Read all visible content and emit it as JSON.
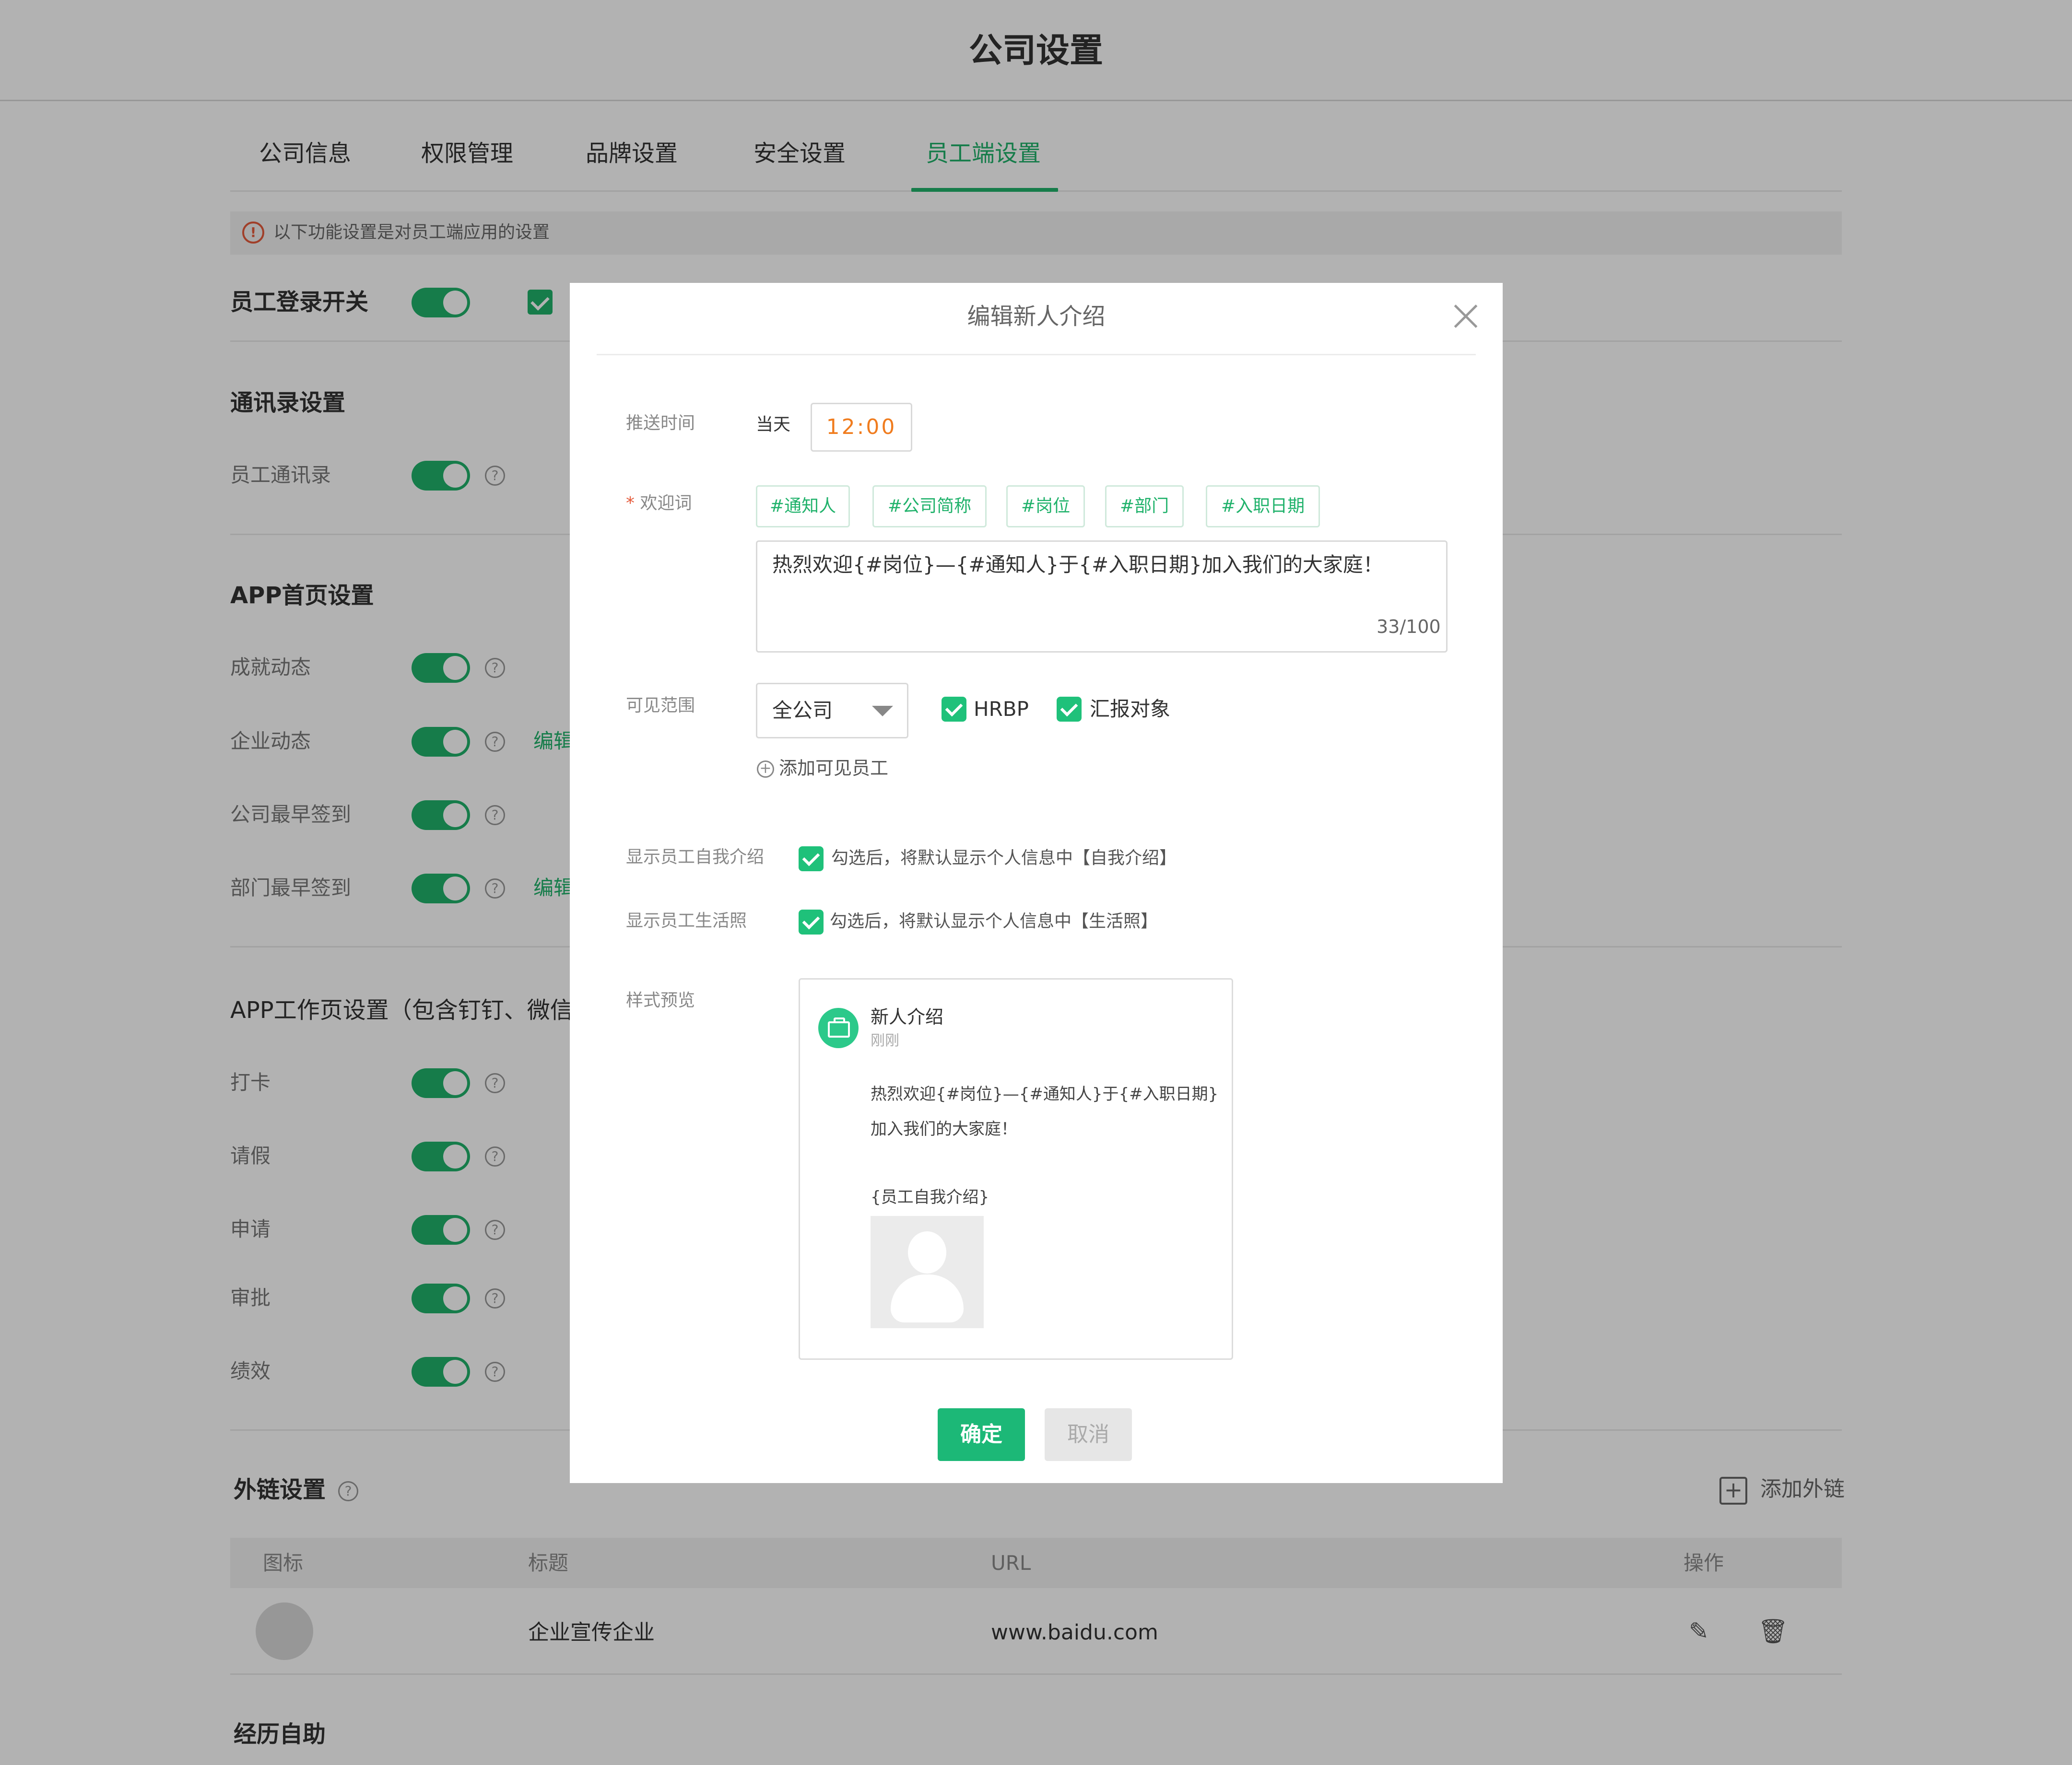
{
  "page": {
    "title": "公司设置"
  },
  "tabs": [
    {
      "label": "公司信息"
    },
    {
      "label": "权限管理"
    },
    {
      "label": "品牌设置"
    },
    {
      "label": "安全设置"
    },
    {
      "label": "员工端设置",
      "active": true
    }
  ],
  "notice": {
    "text": "以下功能设置是对员工端应用的设置"
  },
  "login_switch": {
    "label": "员工登录开关",
    "enabled": true
  },
  "contacts": {
    "title": "通讯录设置",
    "items": [
      {
        "label": "员工通讯录",
        "enabled": true
      }
    ]
  },
  "app_home": {
    "title": "APP首页设置",
    "items": [
      {
        "label": "成就动态",
        "enabled": true
      },
      {
        "label": "企业动态",
        "enabled": true,
        "edit": "编辑"
      },
      {
        "label": "公司最早签到",
        "enabled": true
      },
      {
        "label": "部门最早签到",
        "enabled": true,
        "edit": "编辑"
      }
    ]
  },
  "app_work": {
    "title": "APP工作页设置（包含钉钉、微信",
    "items": [
      {
        "label": "打卡",
        "enabled": true
      },
      {
        "label": "请假",
        "enabled": true
      },
      {
        "label": "申请",
        "enabled": true
      },
      {
        "label": "审批",
        "enabled": true
      },
      {
        "label": "绩效",
        "enabled": true
      }
    ]
  },
  "external_links": {
    "title": "外链设置",
    "add_label": "添加外链",
    "columns": [
      "图标",
      "标题",
      "URL",
      "操作"
    ],
    "rows": [
      {
        "title": "企业宣传企业",
        "url": "www.baidu.com"
      }
    ]
  },
  "bottom_section": {
    "title": "经历自助"
  },
  "modal": {
    "title": "编辑新人介绍",
    "push_time": {
      "label": "推送时间",
      "day": "当天",
      "time": "12:00"
    },
    "welcome": {
      "required_mark": "*",
      "label": "欢迎词",
      "tags": [
        "#通知人",
        "#公司简称",
        "#岗位",
        "#部门",
        "#入职日期"
      ],
      "text": "热烈欢迎{#岗位}—{#通知人}于{#入职日期}加入我们的大家庭！",
      "count": "33/100"
    },
    "visibility": {
      "label": "可见范围",
      "select_value": "全公司",
      "checkboxes": [
        {
          "label": "HRBP",
          "checked": true
        },
        {
          "label": "汇报对象",
          "checked": true
        }
      ],
      "add_label": "添加可见员工"
    },
    "show_intro": {
      "label": "显示员工自我介绍",
      "checked": true,
      "text": "勾选后，将默认显示个人信息中【自我介绍】"
    },
    "show_photo": {
      "label": "显示员工生活照",
      "checked": true,
      "text": "勾选后，将默认显示个人信息中【生活照】"
    },
    "preview": {
      "label": "样式预览",
      "card_title": "新人介绍",
      "card_time": "刚刚",
      "line1": "热烈欢迎{#岗位}—{#通知人}于{#入职日期}",
      "line2": "加入我们的大家庭！",
      "intro_placeholder": "{员工自我介绍}"
    },
    "confirm_label": "确定",
    "cancel_label": "取消"
  },
  "colors": {
    "accent": "#20b26b",
    "warning": "#e55b3c",
    "time_text": "#f07c1e"
  }
}
